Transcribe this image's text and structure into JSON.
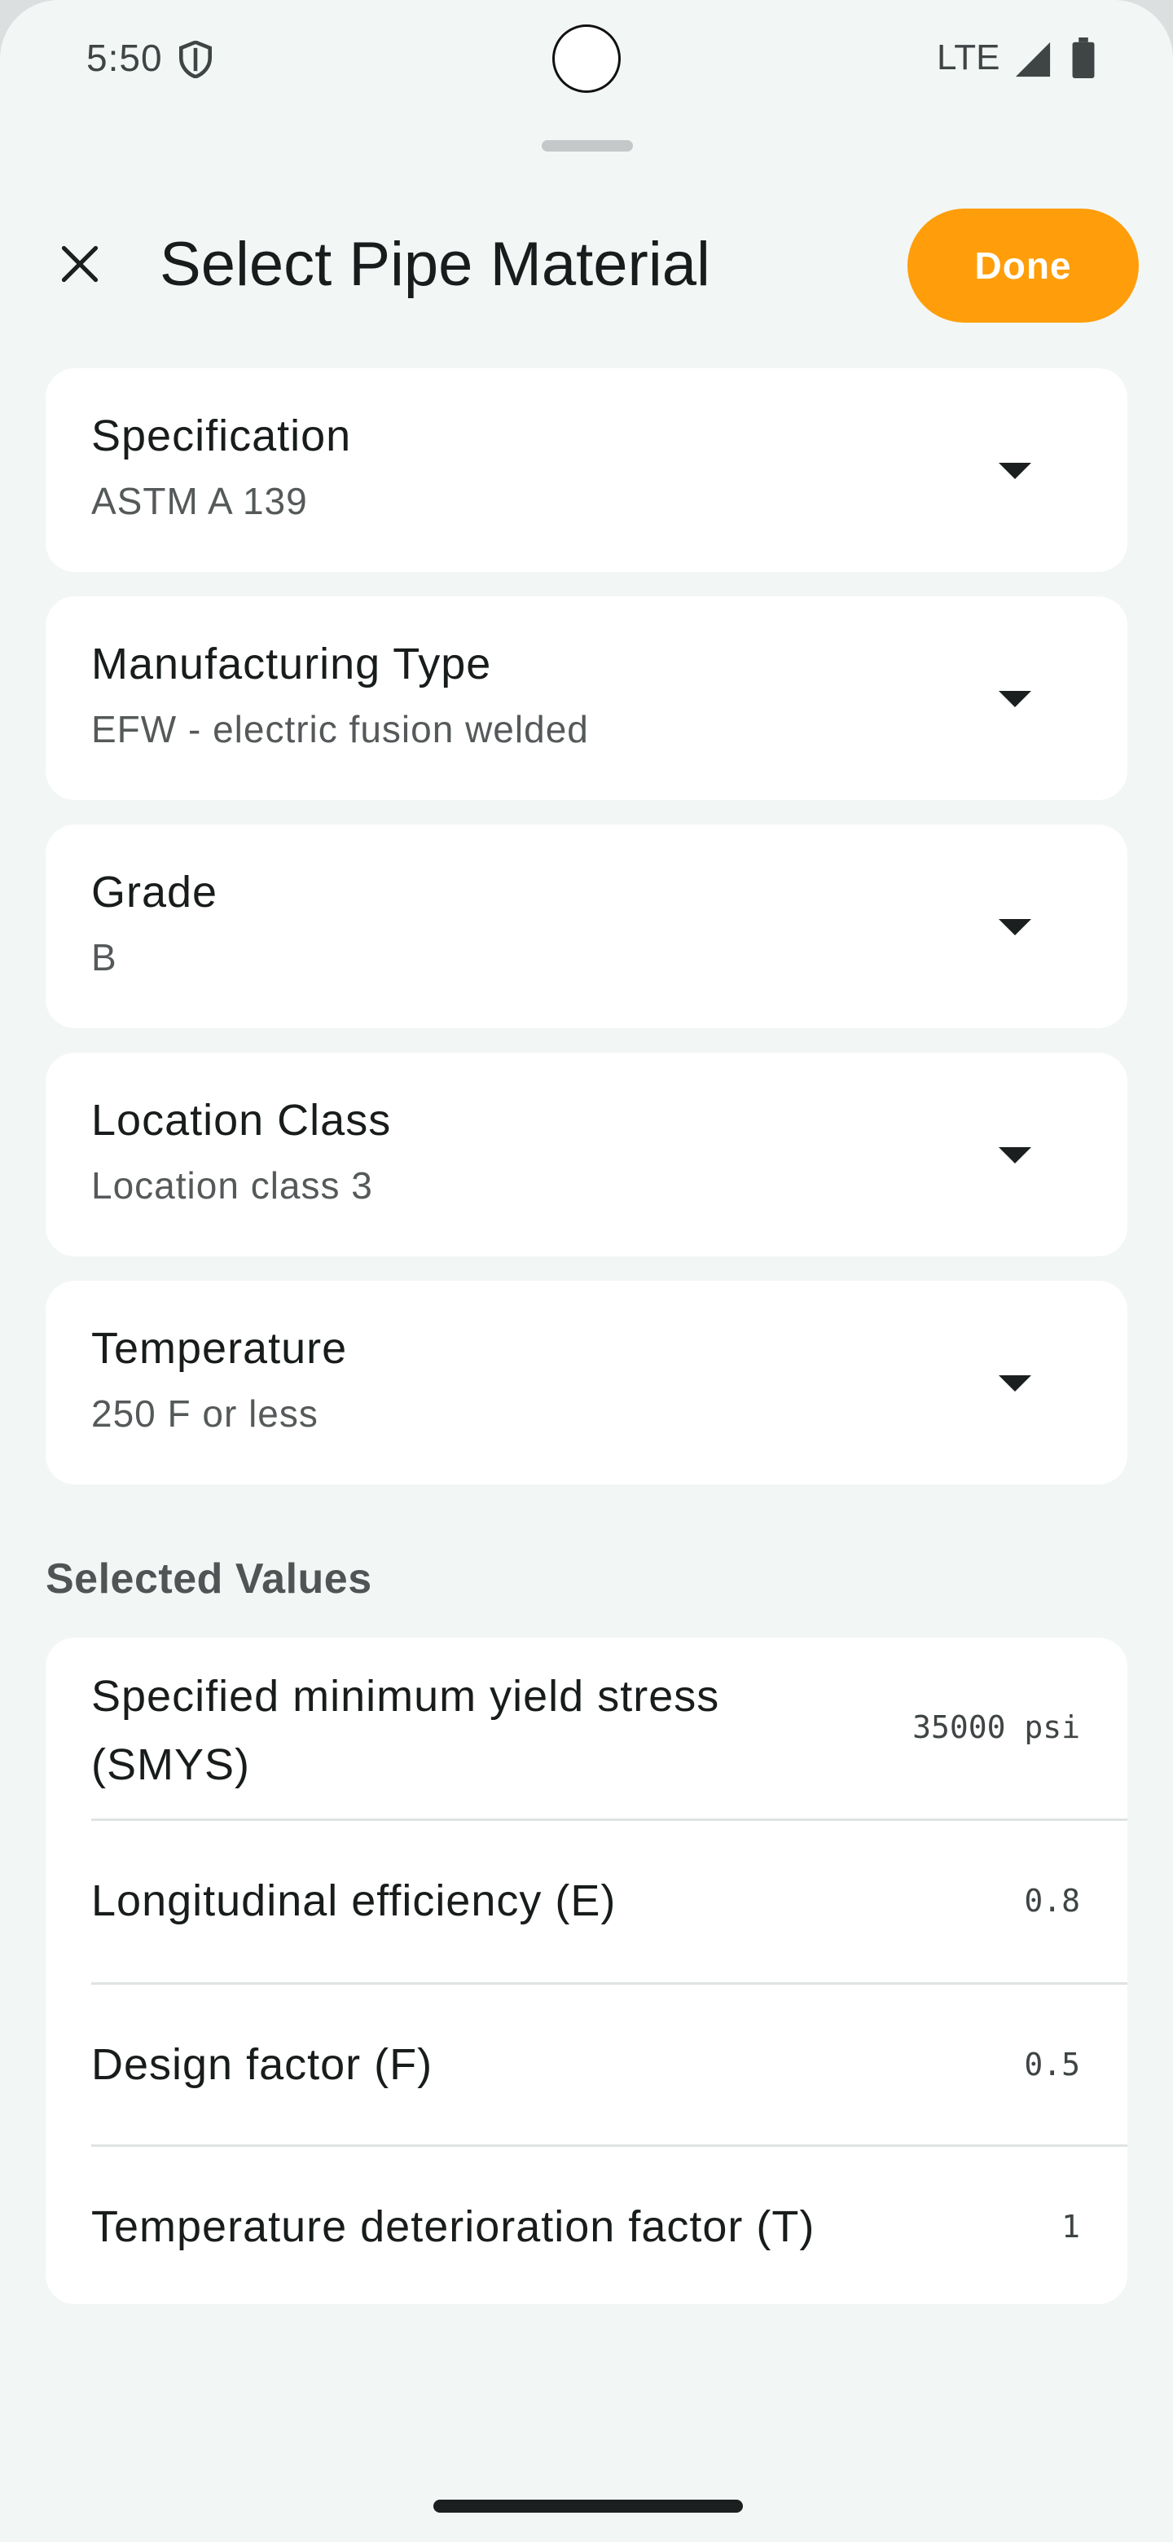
{
  "status_bar": {
    "time": "5:50",
    "network": "LTE",
    "icons": [
      "shield-icon",
      "signal-icon",
      "battery-icon"
    ]
  },
  "header": {
    "title": "Select Pipe Material",
    "close_icon": "close-icon",
    "done_label": "Done"
  },
  "dropdowns": [
    {
      "label": "Specification",
      "value": "ASTM A 139"
    },
    {
      "label": "Manufacturing Type",
      "value": "EFW - electric fusion welded"
    },
    {
      "label": "Grade",
      "value": "B"
    },
    {
      "label": "Location Class",
      "value": "Location class 3"
    },
    {
      "label": "Temperature",
      "value": "250 F or less"
    }
  ],
  "selected_values": {
    "title": "Selected Values",
    "rows": [
      {
        "label": "Specified minimum yield stress (SMYS)",
        "value": "35000 psi"
      },
      {
        "label": "Longitudinal efficiency (E)",
        "value": "0.8"
      },
      {
        "label": "Design factor (F)",
        "value": "0.5"
      },
      {
        "label": "Temperature deterioration factor (T)",
        "value": "1"
      }
    ]
  },
  "colors": {
    "accent": "#ff9e0a",
    "background": "#f2f6f5",
    "card": "#ffffff"
  }
}
